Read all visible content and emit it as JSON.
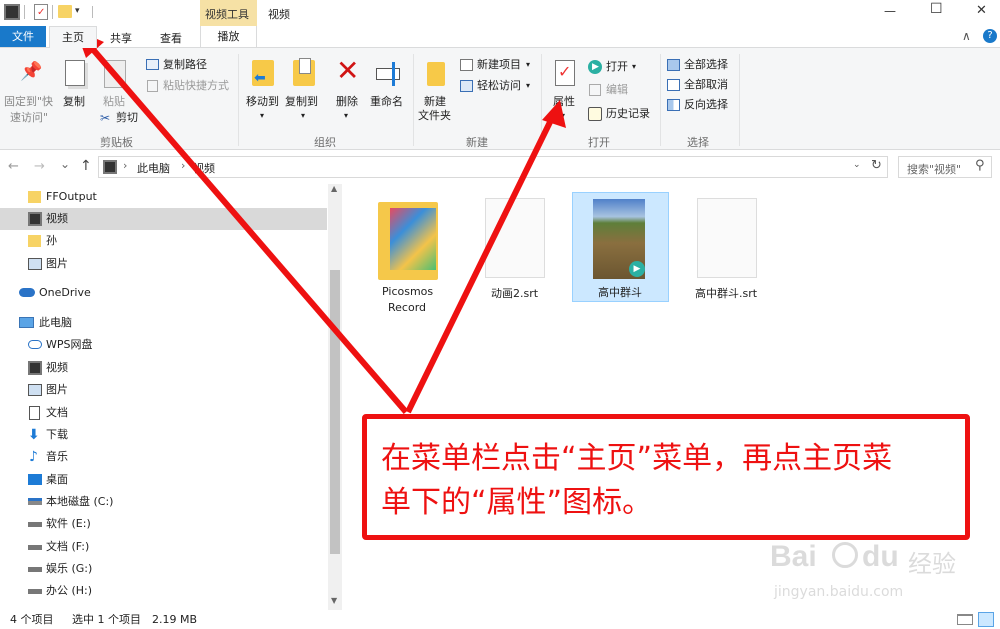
{
  "titlebar": {
    "contextual_tab_group": "视频工具",
    "window_title": "视频",
    "min_glyph": "—",
    "max_glyph": "☐",
    "close_glyph": "✕"
  },
  "tabs": {
    "file": "文件",
    "home": "主页",
    "share": "共享",
    "view": "查看",
    "play": "播放",
    "collapse_glyph": "∧",
    "help_glyph": "?"
  },
  "ribbon": {
    "clipboard": {
      "pin_label_1": "固定到\"快",
      "pin_label_2": "速访问\"",
      "copy": "复制",
      "paste": "粘贴",
      "copy_path": "复制路径",
      "paste_shortcut": "粘贴快捷方式",
      "cut": "剪切",
      "group": "剪贴板"
    },
    "organize": {
      "move_to": "移动到",
      "copy_to": "复制到",
      "delete": "删除",
      "rename": "重命名",
      "group": "组织"
    },
    "new": {
      "new_folder_1": "新建",
      "new_folder_2": "文件夹",
      "new_item": "新建项目",
      "easy_access": "轻松访问",
      "group": "新建"
    },
    "open": {
      "properties": "属性",
      "open": "打开",
      "edit": "编辑",
      "history": "历史记录",
      "group": "打开"
    },
    "select": {
      "select_all": "全部选择",
      "select_none": "全部取消",
      "invert": "反向选择",
      "group": "选择"
    }
  },
  "address": {
    "back_glyph": "←",
    "forward_glyph": "→",
    "recent_glyph": "⌄",
    "up_glyph": "↑",
    "crumb_1": "此电脑",
    "crumb_2": "视频",
    "sep_glyph": "›",
    "refresh_glyph": "↻",
    "search_placeholder": "搜索\"视频\"",
    "search_glyph": "⚲"
  },
  "nav": {
    "quick": [
      "FFOutput",
      "视频",
      "孙",
      "图片"
    ],
    "onedrive": "OneDrive",
    "thispc": "此电脑",
    "pc_items": [
      "WPS网盘",
      "视频",
      "图片",
      "文档",
      "下载",
      "音乐",
      "桌面",
      "本地磁盘 (C:)",
      "软件 (E:)",
      "文档 (F:)",
      "娱乐 (G:)",
      "办公 (H:)"
    ]
  },
  "files": [
    {
      "name_1": "Picosmos",
      "name_2": "Record",
      "type": "folder"
    },
    {
      "name_1": "动画2.srt",
      "name_2": "",
      "type": "doc"
    },
    {
      "name_1": "高中群斗",
      "name_2": "",
      "type": "video"
    },
    {
      "name_1": "高中群斗.srt",
      "name_2": "",
      "type": "doc"
    }
  ],
  "status": {
    "count": "4 个项目",
    "selected": "选中 1 个项目",
    "size": "2.19 MB"
  },
  "annotation": {
    "line_1": "在菜单栏点击“主页”菜单，再点主页菜",
    "line_2": "单下的“属性”图标。"
  },
  "watermark": {
    "brand": "Bai",
    "brand_2": "du",
    "cn": "经验",
    "url": "jingyan.baidu.com"
  },
  "colors": {
    "accent": "#1979ca",
    "red": "#ee1111",
    "selection": "#cce8ff",
    "nav_selected": "#d9d9d9"
  }
}
